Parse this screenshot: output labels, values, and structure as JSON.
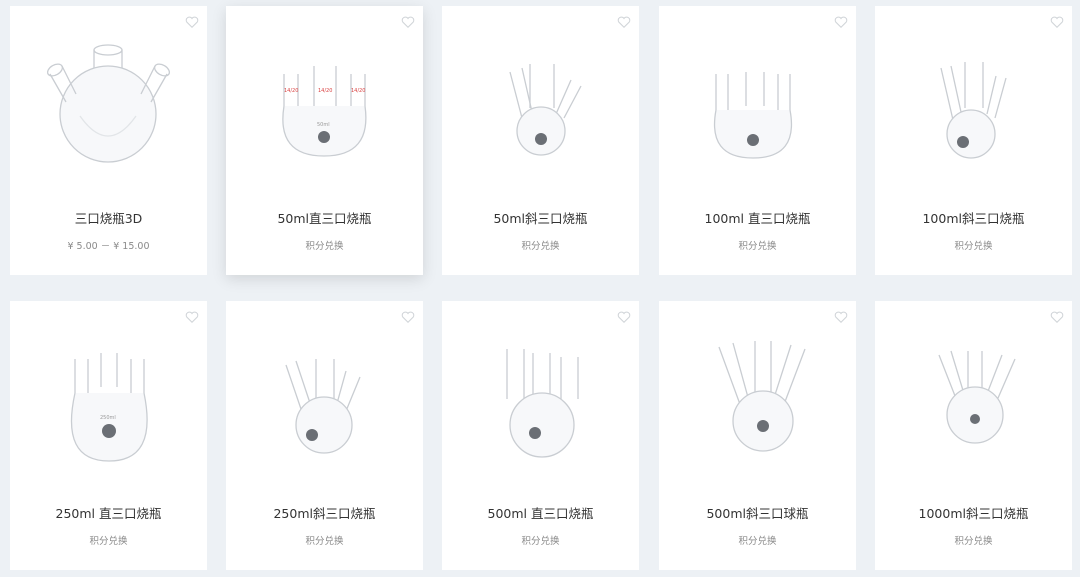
{
  "products": [
    {
      "name": "三口烧瓶3D",
      "sub": "¥ 5.00 － ¥ 15.00",
      "flask": "oblique-ball"
    },
    {
      "name": "50ml直三口烧瓶",
      "sub": "积分兑换",
      "flask": "straight",
      "label": "14/20",
      "vol": "50ml"
    },
    {
      "name": "50ml斜三口烧瓶",
      "sub": "积分兑换",
      "flask": "oblique"
    },
    {
      "name": "100ml 直三口烧瓶",
      "sub": "积分兑换",
      "flask": "straight"
    },
    {
      "name": "100ml斜三口烧瓶",
      "sub": "积分兑换",
      "flask": "oblique"
    },
    {
      "name": "250ml 直三口烧瓶",
      "sub": "积分兑换",
      "flask": "straight",
      "vol": "250ml"
    },
    {
      "name": "250ml斜三口烧瓶",
      "sub": "积分兑换",
      "flask": "oblique"
    },
    {
      "name": "500ml 直三口烧瓶",
      "sub": "积分兑换",
      "flask": "straight"
    },
    {
      "name": "500ml斜三口球瓶",
      "sub": "积分兑换",
      "flask": "oblique"
    },
    {
      "name": "1000ml斜三口烧瓶",
      "sub": "积分兑换",
      "flask": "oblique"
    }
  ],
  "colors": {
    "background": "#edf1f5",
    "card": "#ffffff",
    "title": "#333333",
    "subtitle": "#8a8a8a",
    "accent": "#d94040"
  }
}
